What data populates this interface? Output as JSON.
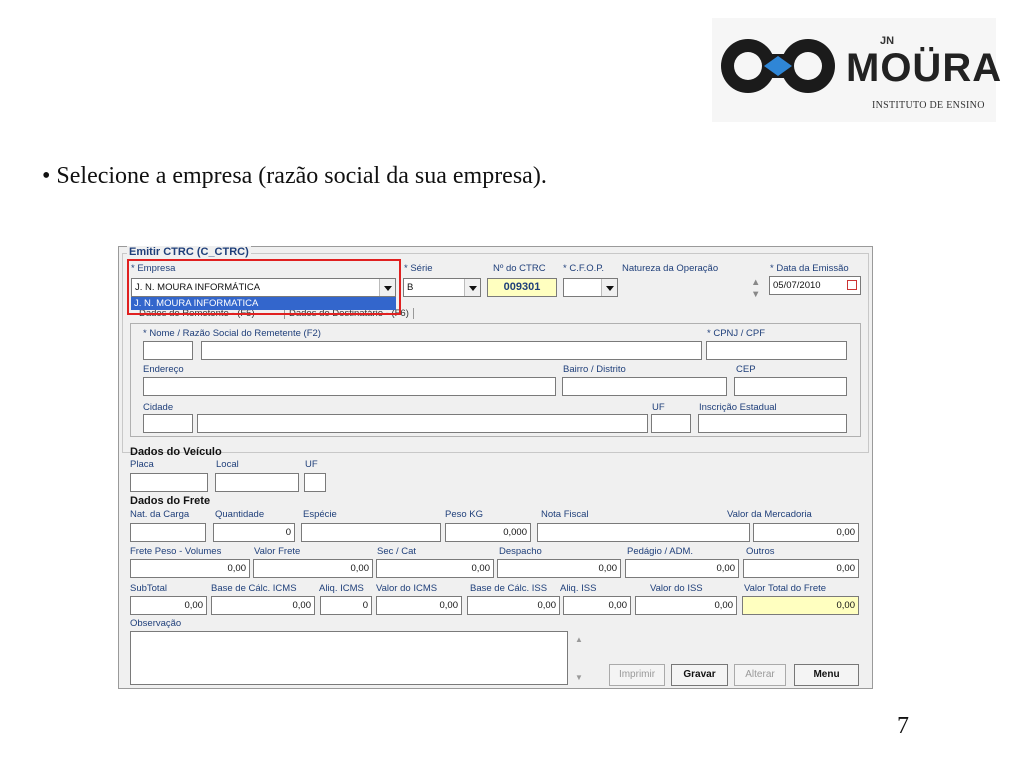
{
  "slide": {
    "bullet": "• Selecione a empresa (razão social da sua empresa).",
    "page_number": "7"
  },
  "logo": {
    "text": "MOÜRA",
    "jn": "JN",
    "subtitle": "INSTITUTO DE ENSINO"
  },
  "window": {
    "title": "Emitir CTRC (C_CTRC)",
    "header": {
      "empresa_label": "* Empresa",
      "empresa_value": "J. N. MOURA INFORMÁTICA",
      "empresa_option": "J. N. MOURA INFORMATICA",
      "serie_label": "* Série",
      "serie_value": "B",
      "nctrc_label": "Nº do CTRC",
      "nctrc_value": "009301",
      "cfop_label": "* C.F.O.P.",
      "natureza_label": "Natureza da Operação",
      "data_label": "* Data da Emissão",
      "data_value": "05/07/2010"
    },
    "tabs": [
      "Dados do Remetente - (F5)",
      "Dados do Destinatário - (F6)"
    ],
    "remetente": {
      "nome_label": "* Nome / Razão Social do Remetente (F2)",
      "cpnj_label": "* CPNJ / CPF",
      "endereco_label": "Endereço",
      "bairro_label": "Bairro / Distrito",
      "cep_label": "CEP",
      "cidade_label": "Cidade",
      "uf_label": "UF",
      "ie_label": "Inscrição Estadual"
    },
    "veiculo": {
      "title": "Dados do Veículo",
      "placa_label": "Placa",
      "local_label": "Local",
      "uf_label": "UF"
    },
    "frete": {
      "title": "Dados do Frete",
      "row1": {
        "nat_label": "Nat. da Carga",
        "qtd_label": "Quantidade",
        "qtd_value": "0",
        "especie_label": "Espécie",
        "peso_label": "Peso KG",
        "peso_value": "0,000",
        "nota_label": "Nota Fiscal",
        "valor_merc_label": "Valor da Mercadoria",
        "valor_merc_value": "0,00"
      },
      "row2": {
        "frete_peso_label": "Frete Peso - Volumes",
        "frete_peso_value": "0,00",
        "valor_frete_label": "Valor Frete",
        "valor_frete_value": "0,00",
        "sec_cat_label": "Sec / Cat",
        "sec_cat_value": "0,00",
        "despacho_label": "Despacho",
        "despacho_value": "0,00",
        "pedagio_label": "Pedágio / ADM.",
        "pedagio_value": "0,00",
        "outros_label": "Outros",
        "outros_value": "0,00"
      },
      "row3": {
        "subtotal_label": "SubTotal",
        "subtotal_value": "0,00",
        "base_icms_label": "Base de Cálc. ICMS",
        "base_icms_value": "0,00",
        "aliq_icms_label": "Aliq. ICMS",
        "aliq_icms_value": "0",
        "valor_icms_label": "Valor do ICMS",
        "valor_icms_value": "0,00",
        "base_iss_label": "Base de Cálc. ISS",
        "base_iss_value": "0,00",
        "aliq_iss_label": "Aliq. ISS",
        "aliq_iss_value": "0,00",
        "valor_iss_label": "Valor do ISS",
        "valor_iss_value": "0,00",
        "total_label": "Valor Total do Frete",
        "total_value": "0,00"
      }
    },
    "observacao_label": "Observação",
    "buttons": {
      "imprimir": "Imprimir",
      "gravar": "Gravar",
      "alterar": "Alterar",
      "menu": "Menu"
    }
  },
  "colors": {
    "highlight_border": "#e02020",
    "selection_blue": "#3366cc",
    "total_yellow": "#ffffc0",
    "title_blue": "#1f3f7a"
  }
}
